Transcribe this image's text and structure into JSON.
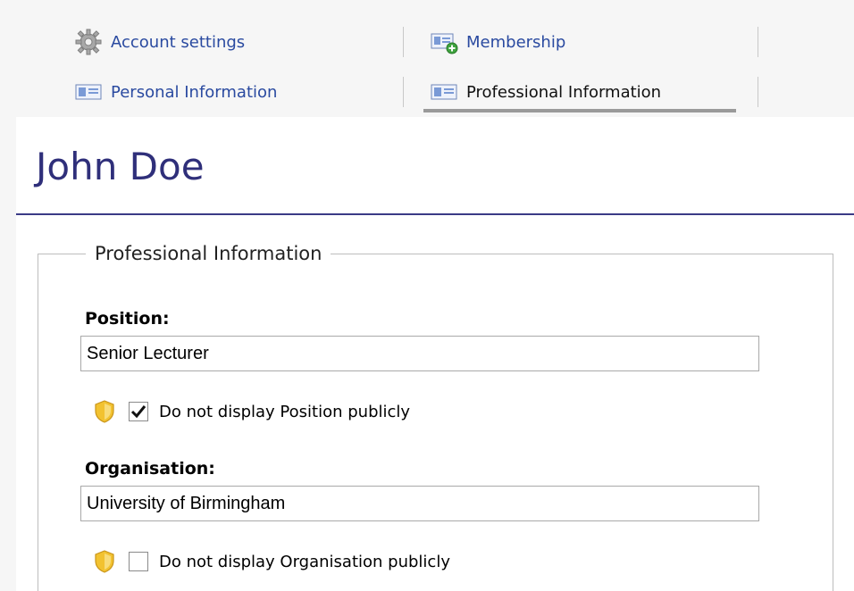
{
  "tabs": {
    "account_settings": "Account settings",
    "membership": "Membership",
    "personal_information": "Personal Information",
    "professional_information": "Professional Information",
    "active": "professional_information"
  },
  "profile": {
    "name": "John Doe"
  },
  "section": {
    "legend": "Professional Information"
  },
  "fields": {
    "position": {
      "label": "Position:",
      "value": "Senior Lecturer",
      "privacy_label": "Do not display Position publicly",
      "privacy_checked": true
    },
    "organisation": {
      "label": "Organisation:",
      "value": "University of Birmingham",
      "privacy_label": "Do not display Organisation publicly",
      "privacy_checked": false
    }
  },
  "icons": {
    "account_settings": "gear-icon",
    "membership": "id-card-add-icon",
    "personal_information": "id-card-icon",
    "professional_information": "id-card-icon",
    "privacy": "shield-icon",
    "checkmark": "checkmark-icon"
  },
  "colors": {
    "title": "#2f2f7a",
    "link": "#2a4aa0",
    "rule": "#3a3a86",
    "shield": "#f2c230"
  }
}
